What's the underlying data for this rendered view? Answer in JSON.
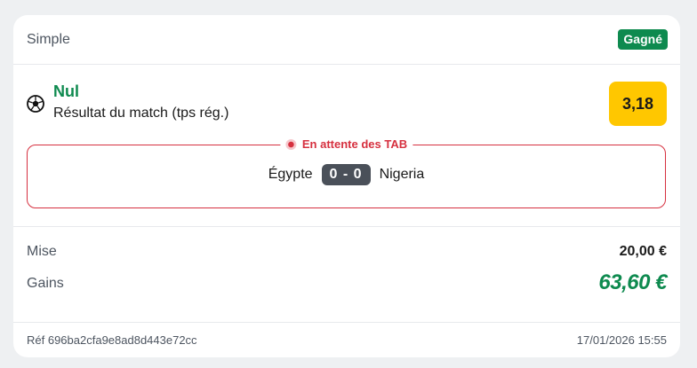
{
  "bet": {
    "type_label": "Simple",
    "result_badge": "Gagné"
  },
  "selection": {
    "icon": "soccer-ball-icon",
    "name": "Nul",
    "market": "Résultat du match (tps rég.)",
    "odds": "3,18"
  },
  "match": {
    "status": "En attente des TAB",
    "home_team": "Égypte",
    "score": "0 - 0",
    "away_team": "Nigeria"
  },
  "summary": {
    "stake_label": "Mise",
    "stake_value": "20,00 €",
    "winnings_label": "Gains",
    "winnings_value": "63,60 €"
  },
  "footer": {
    "reference": "Réf 696ba2cfa9e8ad8d443e72cc",
    "datetime": "17/01/2026 15:55"
  },
  "colors": {
    "win_green": "#0e8a4f",
    "odds_yellow": "#ffc700",
    "status_red": "#d6303f",
    "score_bg": "#4a5059"
  }
}
